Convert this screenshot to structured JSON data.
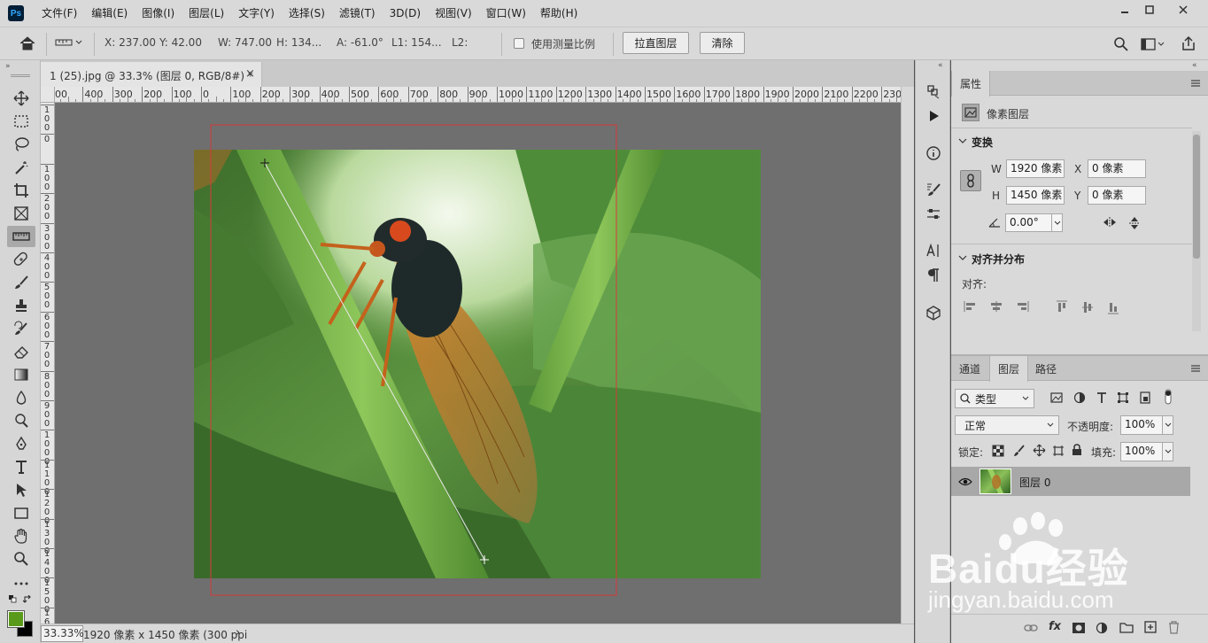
{
  "menubar": {
    "logo": "Ps",
    "items": [
      "文件(F)",
      "编辑(E)",
      "图像(I)",
      "图层(L)",
      "文字(Y)",
      "选择(S)",
      "滤镜(T)",
      "3D(D)",
      "视图(V)",
      "窗口(W)",
      "帮助(H)"
    ]
  },
  "options": {
    "x": "X: 237.00",
    "y": "Y: 42.00",
    "w": "W: 747.00",
    "h": "H: 134...",
    "a": "A: -61.0°",
    "l1": "L1: 154...",
    "l2": "L2:",
    "use_scale_label": "使用测量比例",
    "straighten_button": "拉直图层",
    "clear_button": "清除"
  },
  "document": {
    "tab_title": "1 (25).jpg @ 33.3% (图层 0, RGB/8#) *",
    "close_glyph": "×"
  },
  "ruler": {
    "top_labels": [
      "00",
      "400",
      "300",
      "200",
      "100",
      "0",
      "100",
      "200",
      "300",
      "400",
      "500",
      "600",
      "700",
      "800",
      "900",
      "1000",
      "1100",
      "1200",
      "1300",
      "1400",
      "1500",
      "1600",
      "1700",
      "1800",
      "1900",
      "2000",
      "2100",
      "2200",
      "2300"
    ],
    "left_labels": [
      "100",
      "0",
      "100",
      "200",
      "300",
      "400",
      "500",
      "600",
      "700",
      "800",
      "900",
      "1000",
      "1100",
      "1200",
      "1300",
      "1400",
      "1500",
      "1600"
    ]
  },
  "status": {
    "zoom": "33.33%",
    "info": "1920 像素 x 1450 像素 (300 ppi",
    "arrow": "›"
  },
  "properties": {
    "tab": "属性",
    "layer_type": "像素图层",
    "transform_title": "变换",
    "w_label": "W",
    "w_value": "1920 像素",
    "x_label": "X",
    "x_value": "0 像素",
    "h_label": "H",
    "h_value": "1450 像素",
    "y_label": "Y",
    "y_value": "0 像素",
    "angle_value": "0.00°",
    "align_title": "对齐并分布",
    "align_label": "对齐:"
  },
  "layers": {
    "tabs": [
      "通道",
      "图层",
      "路径"
    ],
    "active_tab": "图层",
    "filter_kind": "类型",
    "blend_mode": "正常",
    "opacity_label": "不透明度:",
    "opacity_value": "100%",
    "lock_label": "锁定:",
    "fill_label": "填充:",
    "fill_value": "100%",
    "items": [
      {
        "name": "图层 0",
        "visible": true
      }
    ]
  },
  "colors": {
    "foreground": "#5a9a1a",
    "background": "#000000",
    "measure_rect": "#d63a3a"
  },
  "watermark": {
    "brand": "Baidu经验",
    "url": "jingyan.baidu.com"
  }
}
